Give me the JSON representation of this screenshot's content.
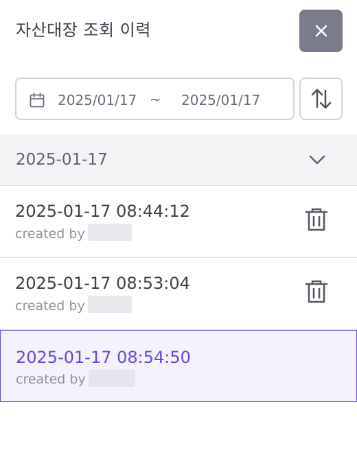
{
  "panel": {
    "title": "자산대장 조회 이력",
    "close_icon": "close-icon"
  },
  "filter": {
    "calendar_icon": "calendar-icon",
    "date_from": "2025/01/17",
    "separator": "~",
    "date_to": "2025/01/17",
    "sort_icon": "sort-arrows-icon"
  },
  "group": {
    "date": "2025-01-17",
    "chevron_icon": "chevron-down-icon"
  },
  "items": [
    {
      "timestamp": "2025-01-17 08:44:12",
      "created_by_label": "created by",
      "selected": false
    },
    {
      "timestamp": "2025-01-17 08:53:04",
      "created_by_label": "created by",
      "selected": false
    },
    {
      "timestamp": "2025-01-17 08:54:50",
      "created_by_label": "created by",
      "selected": true
    }
  ],
  "colors": {
    "accent": "#6a45d9",
    "close_bg": "#7a7c8c",
    "selected_bg": "#f4f2fd",
    "group_bg": "#f3f3f5"
  }
}
